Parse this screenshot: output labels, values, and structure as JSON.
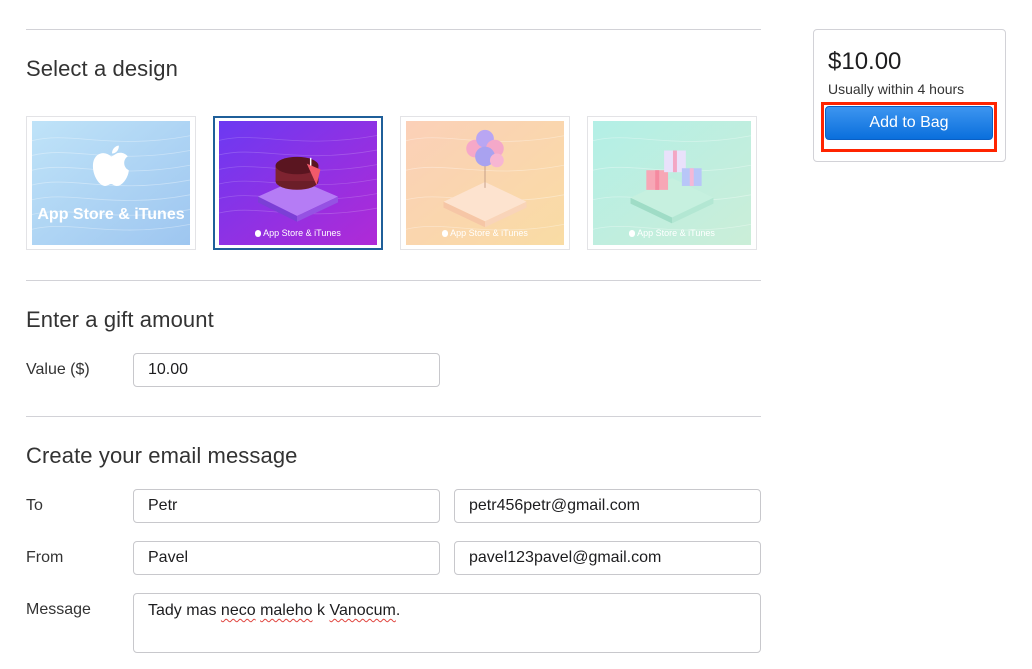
{
  "design_section": {
    "title": "Select a design",
    "options": [
      {
        "caption": "App Store & iTunes",
        "selected": false,
        "theme": "apple-logo",
        "color": "#a9d6f4"
      },
      {
        "caption": "App Store & iTunes",
        "selected": true,
        "theme": "cake",
        "color": "#8f2ee6"
      },
      {
        "caption": "App Store & iTunes",
        "selected": false,
        "theme": "balloons",
        "color": "#f8d2b0"
      },
      {
        "caption": "App Store & iTunes",
        "selected": false,
        "theme": "gifts",
        "color": "#bde9df"
      }
    ]
  },
  "amount_section": {
    "title": "Enter a gift amount",
    "value_label": "Value ($)",
    "value": "10.00"
  },
  "email_section": {
    "title": "Create your email message",
    "to_label": "To",
    "to_name": "Petr",
    "to_email": "petr456petr@gmail.com",
    "from_label": "From",
    "from_name": "Pavel",
    "from_email": "pavel123pavel@gmail.com",
    "message_label": "Message",
    "message_parts": [
      "Tady mas ",
      "neco",
      " ",
      "maleho",
      " k ",
      "Vanocum",
      "."
    ]
  },
  "buy_box": {
    "price": "$10.00",
    "availability": "Usually within 4 hours",
    "add_label": "Add to Bag",
    "highlight_color": "#ff2400",
    "button_color": "#0a6fdc"
  }
}
